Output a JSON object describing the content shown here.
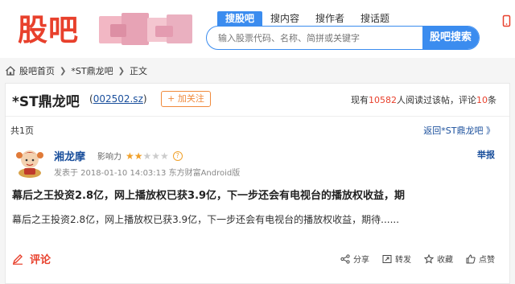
{
  "header": {
    "logo_text": "股吧",
    "search_tabs": [
      "搜股吧",
      "搜内容",
      "搜作者",
      "搜话题"
    ],
    "search_placeholder": "输入股票代码、名称、简拼或关键字",
    "search_button": "股吧搜索",
    "right_edge_icon": "mobile-icon"
  },
  "breadcrumb": {
    "items": [
      "股吧首页",
      "*ST鼎龙吧",
      "正文"
    ]
  },
  "bar": {
    "title": "*ST鼎龙吧",
    "code": "002502.sz",
    "follow_label": "+ 加关注",
    "stats_prefix": "现有",
    "readers": "10582",
    "stats_middle": "人阅读过该帖，评论",
    "comments": "10",
    "stats_suffix": "条"
  },
  "pagination": {
    "page_count": "共1页",
    "back_link": "返回*ST鼎龙吧 》"
  },
  "post": {
    "author": "湘龙摩",
    "influence_label": "影响力",
    "influence_stars": 2,
    "influence_max": 5,
    "meta": "发表于 2018-01-10 14:03:13 东方财富Android版",
    "report_label": "举报",
    "title": "幕后之王投资2.8亿，网上播放权已获3.9亿，下一步还会有电视台的播放权收益，期",
    "body": "幕后之王投资2.8亿，网上播放权已获3.9亿，下一步还会有电视台的播放权收益，期待......"
  },
  "footer": {
    "comment_label": "评论",
    "actions": [
      "分享",
      "转发",
      "收藏",
      "点赞"
    ]
  },
  "colors": {
    "brand_red": "#e8402c",
    "link_blue": "#1a4f9c",
    "accent_blue": "#3b8cef",
    "orange": "#f08a3c",
    "star": "#f0a12b"
  }
}
